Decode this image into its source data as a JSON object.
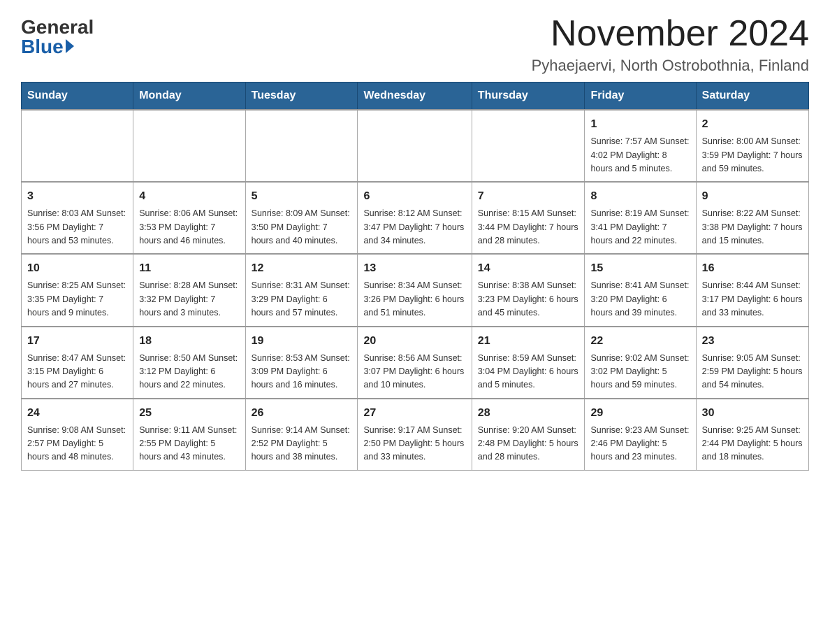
{
  "header": {
    "logo_general": "General",
    "logo_blue": "Blue",
    "month_year": "November 2024",
    "location": "Pyhaejaervi, North Ostrobothnia, Finland"
  },
  "weekdays": [
    "Sunday",
    "Monday",
    "Tuesday",
    "Wednesday",
    "Thursday",
    "Friday",
    "Saturday"
  ],
  "weeks": [
    [
      {
        "day": "",
        "info": ""
      },
      {
        "day": "",
        "info": ""
      },
      {
        "day": "",
        "info": ""
      },
      {
        "day": "",
        "info": ""
      },
      {
        "day": "",
        "info": ""
      },
      {
        "day": "1",
        "info": "Sunrise: 7:57 AM\nSunset: 4:02 PM\nDaylight: 8 hours and 5 minutes."
      },
      {
        "day": "2",
        "info": "Sunrise: 8:00 AM\nSunset: 3:59 PM\nDaylight: 7 hours and 59 minutes."
      }
    ],
    [
      {
        "day": "3",
        "info": "Sunrise: 8:03 AM\nSunset: 3:56 PM\nDaylight: 7 hours and 53 minutes."
      },
      {
        "day": "4",
        "info": "Sunrise: 8:06 AM\nSunset: 3:53 PM\nDaylight: 7 hours and 46 minutes."
      },
      {
        "day": "5",
        "info": "Sunrise: 8:09 AM\nSunset: 3:50 PM\nDaylight: 7 hours and 40 minutes."
      },
      {
        "day": "6",
        "info": "Sunrise: 8:12 AM\nSunset: 3:47 PM\nDaylight: 7 hours and 34 minutes."
      },
      {
        "day": "7",
        "info": "Sunrise: 8:15 AM\nSunset: 3:44 PM\nDaylight: 7 hours and 28 minutes."
      },
      {
        "day": "8",
        "info": "Sunrise: 8:19 AM\nSunset: 3:41 PM\nDaylight: 7 hours and 22 minutes."
      },
      {
        "day": "9",
        "info": "Sunrise: 8:22 AM\nSunset: 3:38 PM\nDaylight: 7 hours and 15 minutes."
      }
    ],
    [
      {
        "day": "10",
        "info": "Sunrise: 8:25 AM\nSunset: 3:35 PM\nDaylight: 7 hours and 9 minutes."
      },
      {
        "day": "11",
        "info": "Sunrise: 8:28 AM\nSunset: 3:32 PM\nDaylight: 7 hours and 3 minutes."
      },
      {
        "day": "12",
        "info": "Sunrise: 8:31 AM\nSunset: 3:29 PM\nDaylight: 6 hours and 57 minutes."
      },
      {
        "day": "13",
        "info": "Sunrise: 8:34 AM\nSunset: 3:26 PM\nDaylight: 6 hours and 51 minutes."
      },
      {
        "day": "14",
        "info": "Sunrise: 8:38 AM\nSunset: 3:23 PM\nDaylight: 6 hours and 45 minutes."
      },
      {
        "day": "15",
        "info": "Sunrise: 8:41 AM\nSunset: 3:20 PM\nDaylight: 6 hours and 39 minutes."
      },
      {
        "day": "16",
        "info": "Sunrise: 8:44 AM\nSunset: 3:17 PM\nDaylight: 6 hours and 33 minutes."
      }
    ],
    [
      {
        "day": "17",
        "info": "Sunrise: 8:47 AM\nSunset: 3:15 PM\nDaylight: 6 hours and 27 minutes."
      },
      {
        "day": "18",
        "info": "Sunrise: 8:50 AM\nSunset: 3:12 PM\nDaylight: 6 hours and 22 minutes."
      },
      {
        "day": "19",
        "info": "Sunrise: 8:53 AM\nSunset: 3:09 PM\nDaylight: 6 hours and 16 minutes."
      },
      {
        "day": "20",
        "info": "Sunrise: 8:56 AM\nSunset: 3:07 PM\nDaylight: 6 hours and 10 minutes."
      },
      {
        "day": "21",
        "info": "Sunrise: 8:59 AM\nSunset: 3:04 PM\nDaylight: 6 hours and 5 minutes."
      },
      {
        "day": "22",
        "info": "Sunrise: 9:02 AM\nSunset: 3:02 PM\nDaylight: 5 hours and 59 minutes."
      },
      {
        "day": "23",
        "info": "Sunrise: 9:05 AM\nSunset: 2:59 PM\nDaylight: 5 hours and 54 minutes."
      }
    ],
    [
      {
        "day": "24",
        "info": "Sunrise: 9:08 AM\nSunset: 2:57 PM\nDaylight: 5 hours and 48 minutes."
      },
      {
        "day": "25",
        "info": "Sunrise: 9:11 AM\nSunset: 2:55 PM\nDaylight: 5 hours and 43 minutes."
      },
      {
        "day": "26",
        "info": "Sunrise: 9:14 AM\nSunset: 2:52 PM\nDaylight: 5 hours and 38 minutes."
      },
      {
        "day": "27",
        "info": "Sunrise: 9:17 AM\nSunset: 2:50 PM\nDaylight: 5 hours and 33 minutes."
      },
      {
        "day": "28",
        "info": "Sunrise: 9:20 AM\nSunset: 2:48 PM\nDaylight: 5 hours and 28 minutes."
      },
      {
        "day": "29",
        "info": "Sunrise: 9:23 AM\nSunset: 2:46 PM\nDaylight: 5 hours and 23 minutes."
      },
      {
        "day": "30",
        "info": "Sunrise: 9:25 AM\nSunset: 2:44 PM\nDaylight: 5 hours and 18 minutes."
      }
    ]
  ]
}
